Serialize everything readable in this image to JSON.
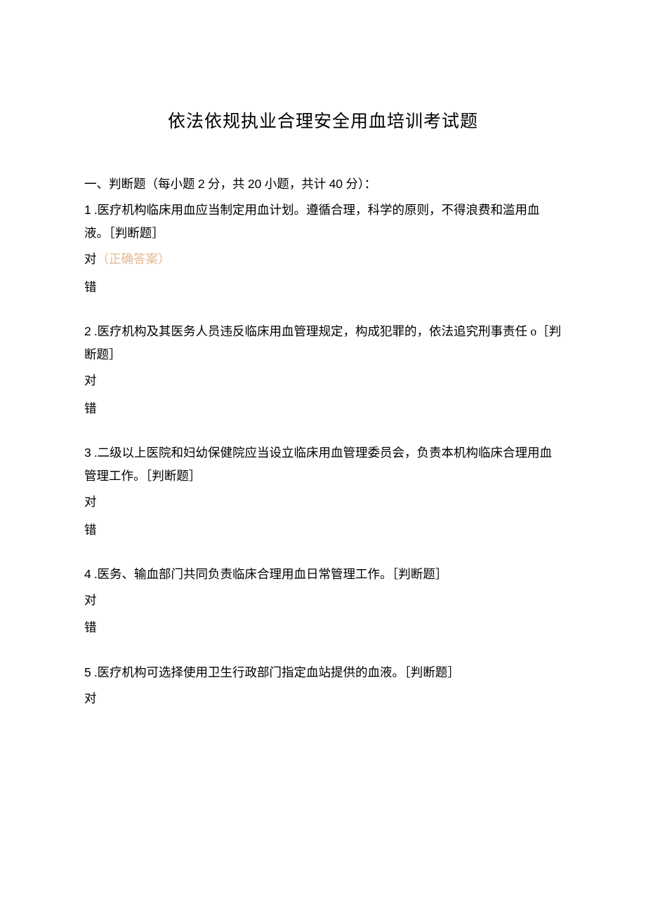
{
  "title": "依法依规执业合理安全用血培训考试题",
  "section_header_pre": "一、判断题（每小题 ",
  "points_per_q": "2",
  "section_header_mid1": " 分，共 ",
  "q_count": "20",
  "section_header_mid2": " 小题，共计 ",
  "total_points": "40",
  "section_header_post": " 分）：",
  "tag": "［判断题］",
  "dot": " .",
  "correct_label": "（正确答案）",
  "opt_true": "对",
  "opt_false": "错",
  "q1_num": "1",
  "q1_text": "医疗机构临床用血应当制定用血计划。遵循合理，科学的原则，不得浪费和滥用血液。",
  "q2_num": "2",
  "q2_text": "医疗机构及其医务人员违反临床用血管理规定，构成犯罪的，依法追究刑事责任 o",
  "q3_num": "3",
  "q3_text": "二级以上医院和妇幼保健院应当设立临床用血管理委员会，负责本机构临床合理用血管理工作。",
  "q4_num": "4",
  "q4_text": "医务、输血部门共同负责临床合理用血日常管理工作。",
  "q5_num": "5",
  "q5_text": "医疗机构可选择使用卫生行政部门指定血站提供的血液。"
}
